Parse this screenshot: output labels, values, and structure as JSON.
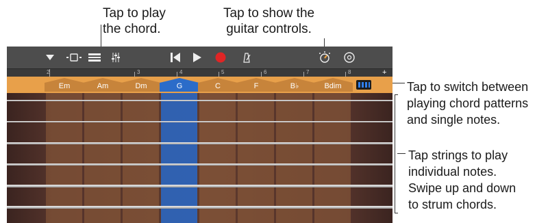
{
  "callouts": {
    "play_chord": "Tap to play\nthe chord.",
    "guitar_controls": "Tap to show the\nguitar controls.",
    "switch_patterns": "Tap to switch between\nplaying chord patterns\nand single notes.",
    "strings": "Tap strings to play\nindividual notes.\nSwipe up and down\nto strum chords."
  },
  "toolbar": {
    "icons": [
      "dropdown-icon",
      "view-icon",
      "tracks-icon",
      "mixer-icon",
      "rewind-icon",
      "play-icon",
      "record-icon",
      "metronome-icon",
      "guitar-controls-icon",
      "settings-icon"
    ]
  },
  "ruler": {
    "marks": [
      "2",
      "3",
      "4",
      "5",
      "6",
      "7",
      "8"
    ],
    "plus": "+"
  },
  "chords": [
    "Em",
    "Am",
    "Dm",
    "G",
    "C",
    "F",
    "B♭",
    "Bdim"
  ],
  "selected_chord": "G",
  "colors": {
    "selected": "#2b6cc9",
    "chord_bar": "#e8a04a",
    "record": "#e02525",
    "toggle": "#2f7ff0"
  }
}
